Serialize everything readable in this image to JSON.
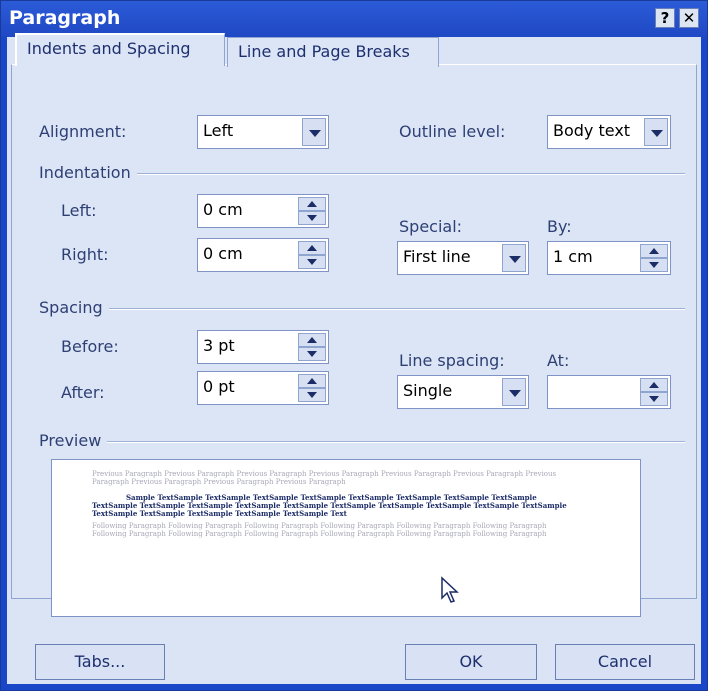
{
  "window": {
    "title": "Paragraph",
    "help_label": "?",
    "close_label": "✕"
  },
  "tabs": [
    {
      "label": "Indents and Spacing",
      "selected": true
    },
    {
      "label": "Line and Page Breaks",
      "selected": false
    }
  ],
  "alignment": {
    "label": "Alignment:",
    "value": "Left"
  },
  "outline": {
    "label": "Outline level:",
    "value": "Body text"
  },
  "indentation": {
    "group": "Indentation",
    "left_label": "Left:",
    "left_value": "0 cm",
    "right_label": "Right:",
    "right_value": "0 cm",
    "special_label": "Special:",
    "special_value": "First line",
    "by_label": "By:",
    "by_value": "1 cm"
  },
  "spacing": {
    "group": "Spacing",
    "before_label": "Before:",
    "before_value": "3 pt",
    "after_label": "After:",
    "after_value": "0 pt",
    "line_label": "Line spacing:",
    "line_value": "Single",
    "at_label": "At:",
    "at_value": ""
  },
  "preview": {
    "group": "Preview",
    "previous": "Previous Paragraph Previous Paragraph Previous Paragraph Previous Paragraph Previous Paragraph Previous Paragraph Previous Paragraph Previous Paragraph Previous Paragraph Previous Paragraph",
    "sample": "Sample TextSample TextSample TextSample TextSample TextSample TextSample TextSample TextSample TextSample TextSample TextSample TextSample TextSample TextSample TextSample TextSample TextSample TextSample TextSample TextSample TextSample TextSample TextSample Text",
    "following": "Following Paragraph Following Paragraph Following Paragraph Following Paragraph Following Paragraph Following Paragraph Following Paragraph Following Paragraph Following Paragraph Following Paragraph Following Paragraph Following Paragraph"
  },
  "buttons": {
    "tabs": "Tabs...",
    "ok": "OK",
    "cancel": "Cancel"
  }
}
